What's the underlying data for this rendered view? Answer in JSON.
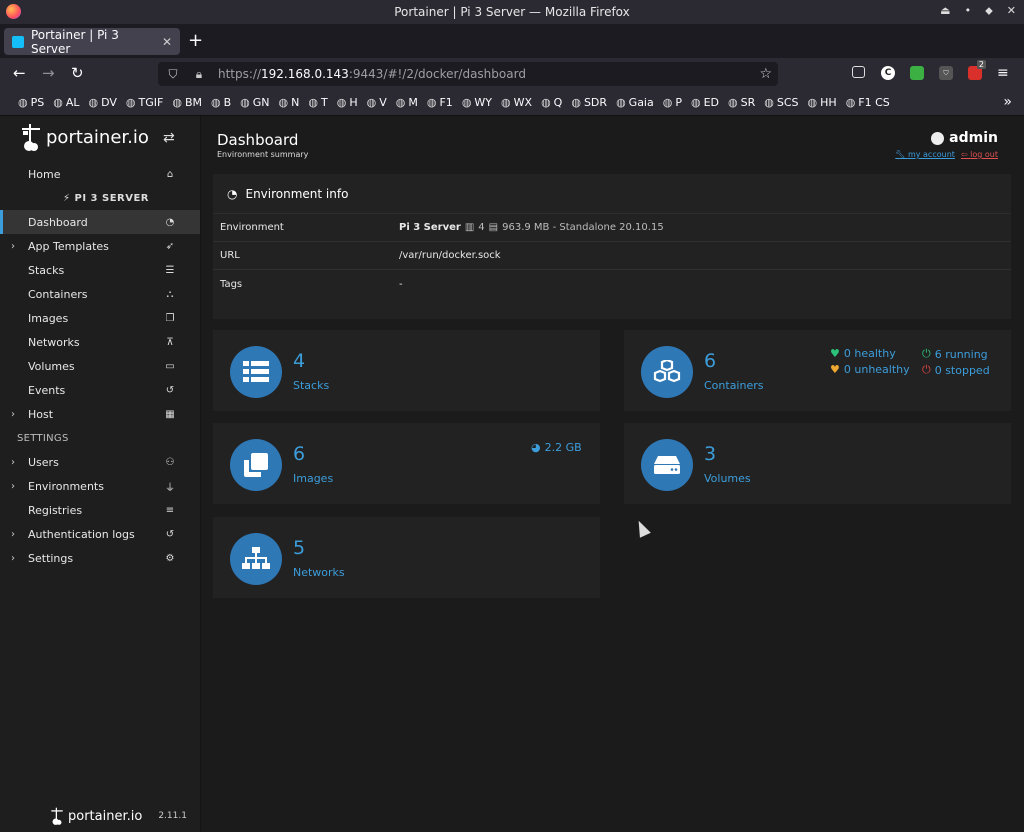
{
  "window": {
    "title": "Portainer | Pi 3 Server — Mozilla Firefox"
  },
  "browser": {
    "tab_title": "Portainer | Pi 3 Server",
    "url_prefix": "https://",
    "url_host": "192.168.0.143",
    "url_rest": ":9443/#!/2/docker/dashboard",
    "ext_badge": "2",
    "bookmarks": [
      "PS",
      "AL",
      "DV",
      "TGIF",
      "BM",
      "B",
      "GN",
      "N",
      "T",
      "H",
      "V",
      "M",
      "F1",
      "WY",
      "WX",
      "Q",
      "SDR",
      "Gaia",
      "P",
      "ED",
      "SR",
      "SCS",
      "HH",
      "F1 CS"
    ]
  },
  "sidebar": {
    "logo_text": "portainer.io",
    "home": "Home",
    "environment": "PI 3 SERVER",
    "items": [
      {
        "label": "Dashboard",
        "icon": "tachometer-icon"
      },
      {
        "label": "App Templates",
        "icon": "rocket-icon"
      },
      {
        "label": "Stacks",
        "icon": "list-icon"
      },
      {
        "label": "Containers",
        "icon": "cubes-icon"
      },
      {
        "label": "Images",
        "icon": "clone-icon"
      },
      {
        "label": "Networks",
        "icon": "sitemap-icon"
      },
      {
        "label": "Volumes",
        "icon": "hdd-icon"
      },
      {
        "label": "Events",
        "icon": "history-icon"
      },
      {
        "label": "Host",
        "icon": "th-icon"
      }
    ],
    "settings_header": "SETTINGS",
    "settings_items": [
      {
        "label": "Users",
        "icon": "users-icon"
      },
      {
        "label": "Environments",
        "icon": "plug-icon"
      },
      {
        "label": "Registries",
        "icon": "database-icon"
      },
      {
        "label": "Authentication logs",
        "icon": "history-icon"
      },
      {
        "label": "Settings",
        "icon": "cogs-icon"
      }
    ],
    "footer_logo": "portainer.io",
    "version": "2.11.1"
  },
  "header": {
    "title": "Dashboard",
    "subtitle": "Environment summary",
    "user": "admin",
    "my_account": "my account",
    "log_out": "log out"
  },
  "env_info": {
    "title": "Environment info",
    "rows": {
      "environment_label": "Environment",
      "environment_name": "Pi 3 Server",
      "cpu": "4",
      "memory": "963.9 MB - Standalone 20.10.15",
      "url_label": "URL",
      "url_value": "/var/run/docker.sock",
      "tags_label": "Tags",
      "tags_value": "-"
    }
  },
  "cards": {
    "stacks": {
      "count": "4",
      "label": "Stacks"
    },
    "containers": {
      "count": "6",
      "label": "Containers",
      "healthy": "0 healthy",
      "unhealthy": "0 unhealthy",
      "running": "6 running",
      "stopped": "0 stopped"
    },
    "images": {
      "count": "6",
      "label": "Images",
      "size": "2.2 GB"
    },
    "volumes": {
      "count": "3",
      "label": "Volumes"
    },
    "networks": {
      "count": "5",
      "label": "Networks"
    }
  },
  "colors": {
    "accent": "#3c9ddb",
    "circle": "#2f78b6",
    "healthy": "#2bc27a",
    "unhealthy": "#f0a830",
    "running": "#2bc27a",
    "stopped": "#e04545"
  }
}
